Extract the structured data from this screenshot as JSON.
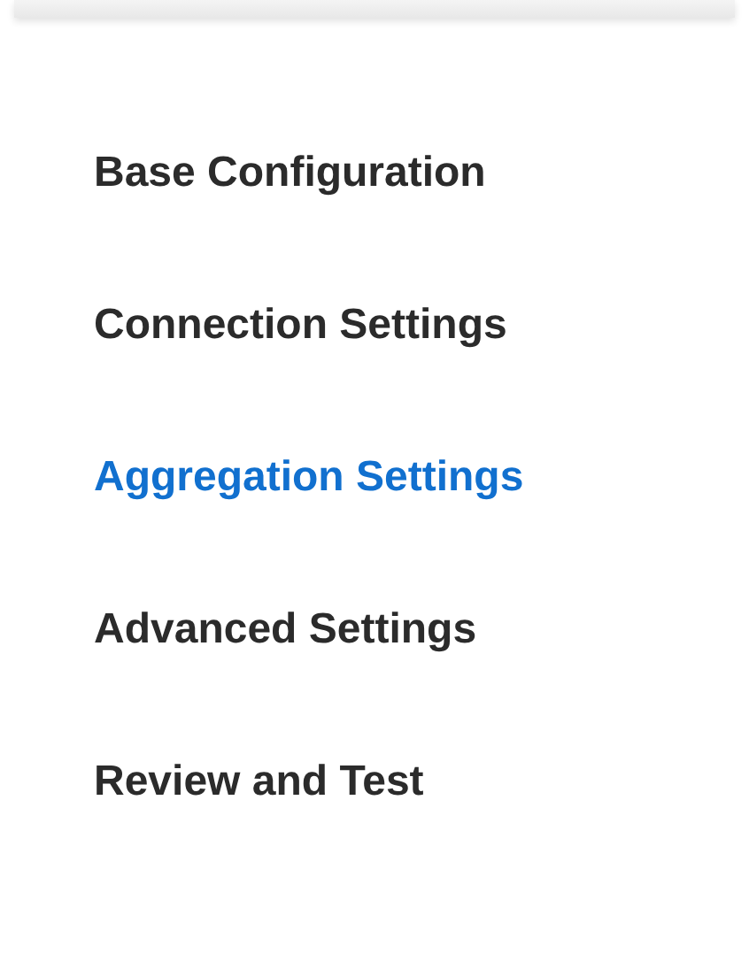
{
  "nav": {
    "items": [
      {
        "label": "Base Configuration",
        "selected": false
      },
      {
        "label": "Connection Settings",
        "selected": false
      },
      {
        "label": "Aggregation Settings",
        "selected": true
      },
      {
        "label": "Advanced Settings",
        "selected": false
      },
      {
        "label": "Review and Test",
        "selected": false
      }
    ]
  }
}
